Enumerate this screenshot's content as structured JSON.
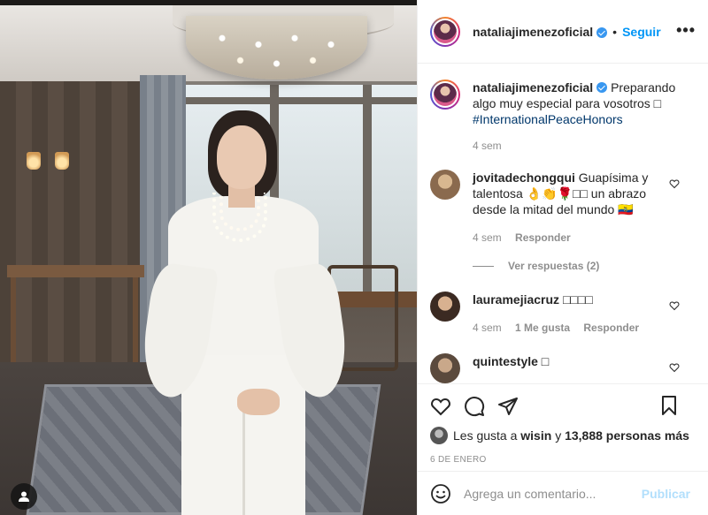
{
  "post": {
    "username": "nataliajimenezoficial",
    "follow_label": "Seguir",
    "dot": "•",
    "more_label": "•••",
    "caption_text": "Preparando algo muy especial para vosotros ",
    "caption_box": "□",
    "caption_hashtag": "#InternationalPeaceHonors",
    "caption_time": "4 sem"
  },
  "comments": [
    {
      "username": "jovitadechongqui",
      "text": "Guapísima y talentosa 👌👏🌹□□ un abrazo desde la mitad del mundo 🇪🇨",
      "time": "4 sem",
      "reply_label": "Responder",
      "view_replies": "Ver respuestas (2)"
    },
    {
      "username": "lauramejiacruz",
      "text": "□□□□",
      "time": "4 sem",
      "likes": "1 Me gusta",
      "reply_label": "Responder"
    },
    {
      "username": "quintestyle",
      "text": "□"
    }
  ],
  "likes": {
    "prefix": "Les gusta a ",
    "user": "wisin",
    "connector": " y ",
    "others": "13,888 personas más"
  },
  "date": "6 DE ENERO",
  "add_comment": {
    "placeholder": "Agrega un comentario...",
    "publish_label": "Publicar"
  },
  "colors": {
    "link_blue": "#0095f6",
    "publish_disabled": "#b2dffc",
    "hashtag": "#00376b",
    "muted": "#8e8e8e"
  },
  "icons": [
    "heart-icon",
    "comment-icon",
    "share-icon",
    "bookmark-icon",
    "emoji-icon",
    "user-tag-icon",
    "verified-icon",
    "more-options-icon"
  ]
}
